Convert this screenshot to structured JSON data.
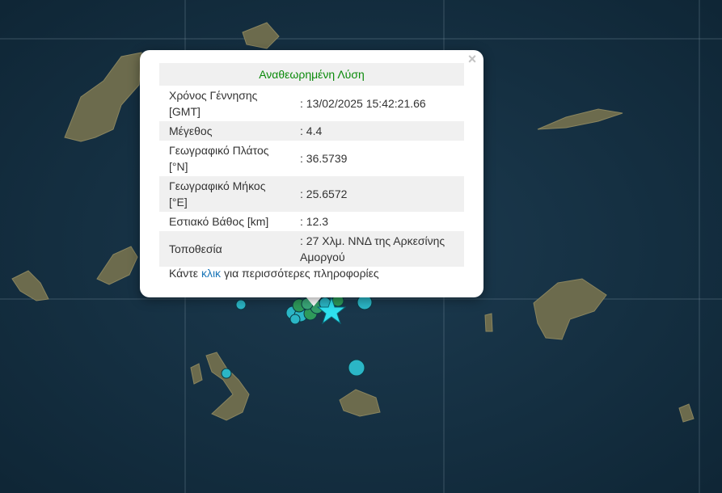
{
  "popup": {
    "title": "Αναθεωρημένη Λύση",
    "close_label": "×",
    "rows": [
      {
        "label_line1": "Χρόνος Γέννησης",
        "label_line2": "[GMT]",
        "value": ": 13/02/2025 15:42:21.66"
      },
      {
        "label_line1": "Μέγεθος",
        "label_line2": "",
        "value": ": 4.4"
      },
      {
        "label_line1": "Γεωγραφικό Πλάτος",
        "label_line2": "[°N]",
        "value": ": 36.5739"
      },
      {
        "label_line1": "Γεωγραφικό Μήκος",
        "label_line2": "[°E]",
        "value": ": 25.6572"
      },
      {
        "label_line1": "Εστιακό Βάθος [km]",
        "label_line2": "",
        "value": ": 12.3"
      },
      {
        "label_line1": "Τοποθεσία",
        "label_line2": "",
        "value_line1": ": 27 Χλμ. ΝΝΔ της Αρκεσίνης",
        "value_line2": "Αμοργού"
      }
    ],
    "more_prefix": "Κάντε",
    "more_link": "κλικ",
    "more_suffix": "για περισσότερες πληροφορίες"
  },
  "colors": {
    "sea": "#163246",
    "land": "#6e6a4e",
    "event_cyan": "#2bb6c6",
    "event_green": "#2e9a5a",
    "star": "#2fe0ef",
    "title_green": "#0a8a0a",
    "link_blue": "#1a76b8"
  },
  "icons": {
    "selected_event": "star-icon",
    "close": "close-icon"
  }
}
